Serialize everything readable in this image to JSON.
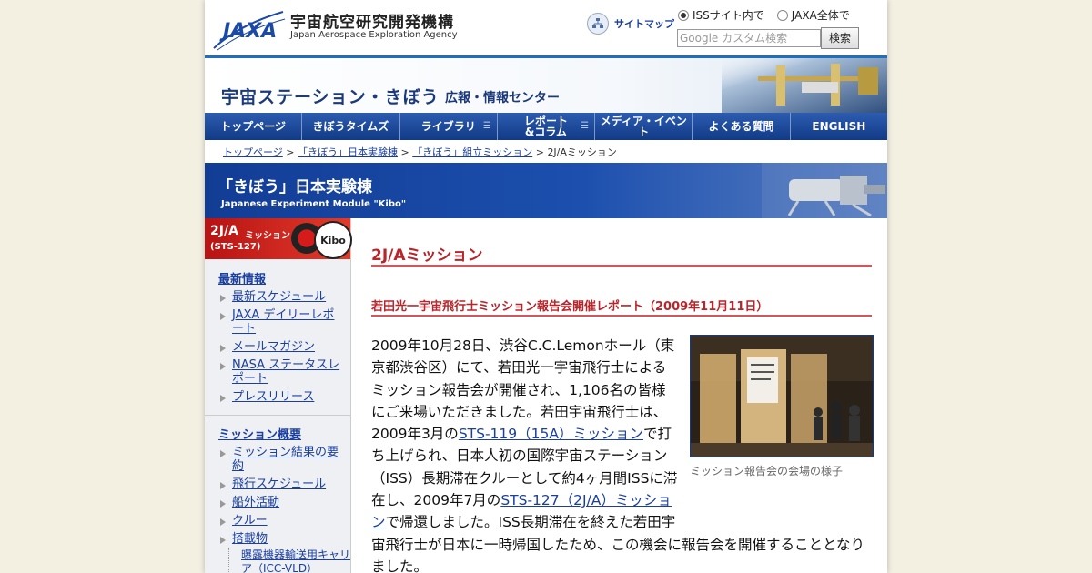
{
  "header": {
    "logo_mark": "JAXA",
    "logo_ja": "宇宙航空研究開発機構",
    "logo_en": "Japan Aerospace Exploration Agency",
    "sitemap_label": "サイトマップ",
    "radio_iss": "ISSサイト内で",
    "radio_jaxa": "JAXA全体で",
    "search_placeholder": "Google カスタム検索",
    "search_button": "検索"
  },
  "banner": {
    "title": "宇宙ステーション・きぼう",
    "subtitle": "広報・情報センター"
  },
  "nav": {
    "items": [
      {
        "label": "トップページ"
      },
      {
        "label": "きぼうタイムズ"
      },
      {
        "label": "ライブラリ"
      },
      {
        "label": "レポート\n&コラム"
      },
      {
        "label": "メディア・イベント"
      },
      {
        "label": "よくある質問"
      },
      {
        "label": "ENGLISH"
      }
    ]
  },
  "breadcrumb": {
    "items": [
      "トップページ",
      "「きぼう」日本実験棟",
      "「きぼう」組立ミッション"
    ],
    "current": "2J/Aミッション",
    "separator": ">"
  },
  "section": {
    "title": "「きぼう」日本実験棟",
    "subtitle": "Japanese Experiment Module \"Kibo\""
  },
  "sidebar": {
    "badge_code": "2J/A",
    "badge_mission": "ミッション",
    "badge_sts": "(STS-127)",
    "badge_kibo": "Kibo",
    "group1_title": "最新情報",
    "group1_items": [
      {
        "label": "最新スケジュール"
      },
      {
        "label": "JAXA デイリーレポート"
      },
      {
        "label": "メールマガジン"
      },
      {
        "label": "NASA ステータスレポート"
      },
      {
        "label": "プレスリリース"
      }
    ],
    "group2_title": "ミッション概要",
    "group2_items": [
      {
        "label": "ミッション結果の要約"
      },
      {
        "label": "飛行スケジュール"
      },
      {
        "label": "船外活動"
      },
      {
        "label": "クルー"
      },
      {
        "label": "搭載物"
      }
    ],
    "sub_item": "曝露機器輸送用キャリア（ICC-VLD）"
  },
  "main": {
    "title": "2J/Aミッション",
    "report_title": "若田光一宇宙飛行士ミッション報告会開催レポート（2009年11月11日）",
    "photo_caption": "ミッション報告会の会場の様子",
    "body_part1": "2009年10月28日、渋谷C.C.Lemonホール（東京都渋谷区）にて、若田光一宇宙飛行士によるミッション報告会が開催され、1,106名の皆様にご来場いただきました。若田宇宙飛行士は、2009年3月の",
    "link1": "STS-119（15A）ミッション",
    "body_part2": "で打ち上げられ、日本人初の国際宇宙ステーション（ISS）長期滞在クルーとして約4ヶ月間ISSに滞在し、2009年7月の",
    "link2": "STS-127（2J/A）ミッション",
    "body_part3": "で帰還しました。ISS長期滞在を終えた若田宇宙飛行士が日本に一時帰国したため、この機会に報告会を開催することとなりました。"
  }
}
